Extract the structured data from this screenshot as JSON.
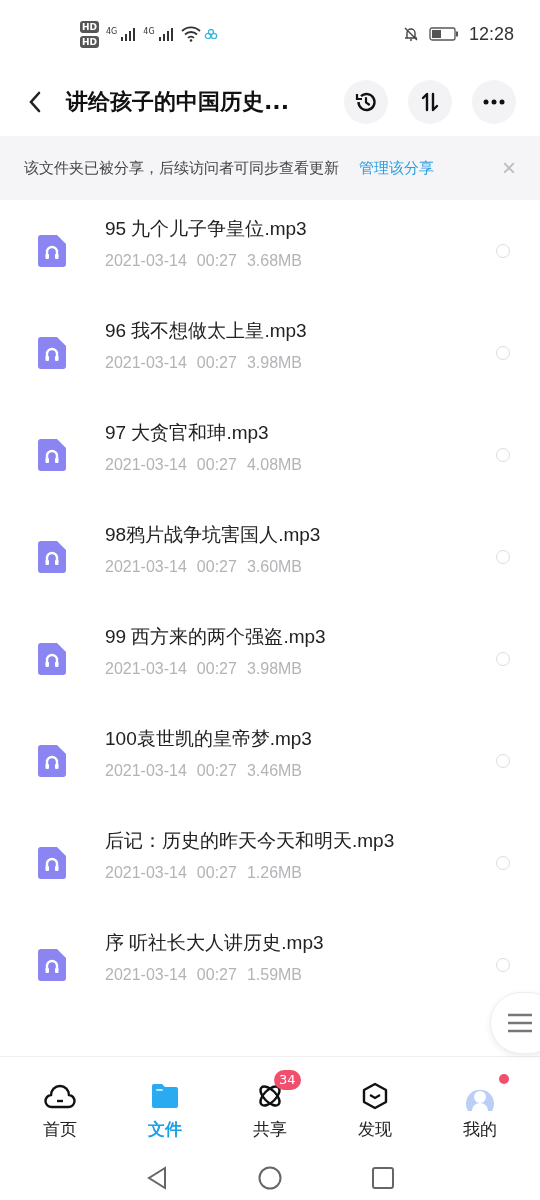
{
  "status_bar": {
    "sim_labels": [
      "HD",
      "HD"
    ],
    "network_labels": [
      "4G",
      "4G"
    ],
    "time": "12:28"
  },
  "header": {
    "title": "讲给孩子的中国历史..."
  },
  "share_banner": {
    "message": "该文件夹已被分享，后续访问者可同步查看更新",
    "link": "管理该分享",
    "close": "×"
  },
  "files": [
    {
      "name": "95 九个儿子争皇位.mp3",
      "date": "2021-03-14",
      "time": "00:27",
      "size": "3.68MB",
      "selected": false
    },
    {
      "name": "96 我不想做太上皇.mp3",
      "date": "2021-03-14",
      "time": "00:27",
      "size": "3.98MB",
      "selected": false
    },
    {
      "name": "97 大贪官和珅.mp3",
      "date": "2021-03-14",
      "time": "00:27",
      "size": "4.08MB",
      "selected": false
    },
    {
      "name": "98鸦片战争坑害国人.mp3",
      "date": "2021-03-14",
      "time": "00:27",
      "size": "3.60MB",
      "selected": false
    },
    {
      "name": "99 西方来的两个强盗.mp3",
      "date": "2021-03-14",
      "time": "00:27",
      "size": "3.98MB",
      "selected": false
    },
    {
      "name": "100袁世凯的皇帝梦.mp3",
      "date": "2021-03-14",
      "time": "00:27",
      "size": "3.46MB",
      "selected": false
    },
    {
      "name": "后记：历史的昨天今天和明天.mp3",
      "date": "2021-03-14",
      "time": "00:27",
      "size": "1.26MB",
      "selected": false
    },
    {
      "name": "序 听社长大人讲历史.mp3",
      "date": "2021-03-14",
      "time": "00:27",
      "size": "1.59MB",
      "selected": false
    }
  ],
  "tabs": [
    {
      "kind": "home",
      "label": "首页",
      "selected": false
    },
    {
      "kind": "files",
      "label": "文件",
      "selected": true
    },
    {
      "kind": "share",
      "label": "共享",
      "selected": false,
      "badge": "34"
    },
    {
      "kind": "discover",
      "label": "发现",
      "selected": false
    },
    {
      "kind": "me",
      "label": "我的",
      "selected": false,
      "dot": true
    }
  ]
}
